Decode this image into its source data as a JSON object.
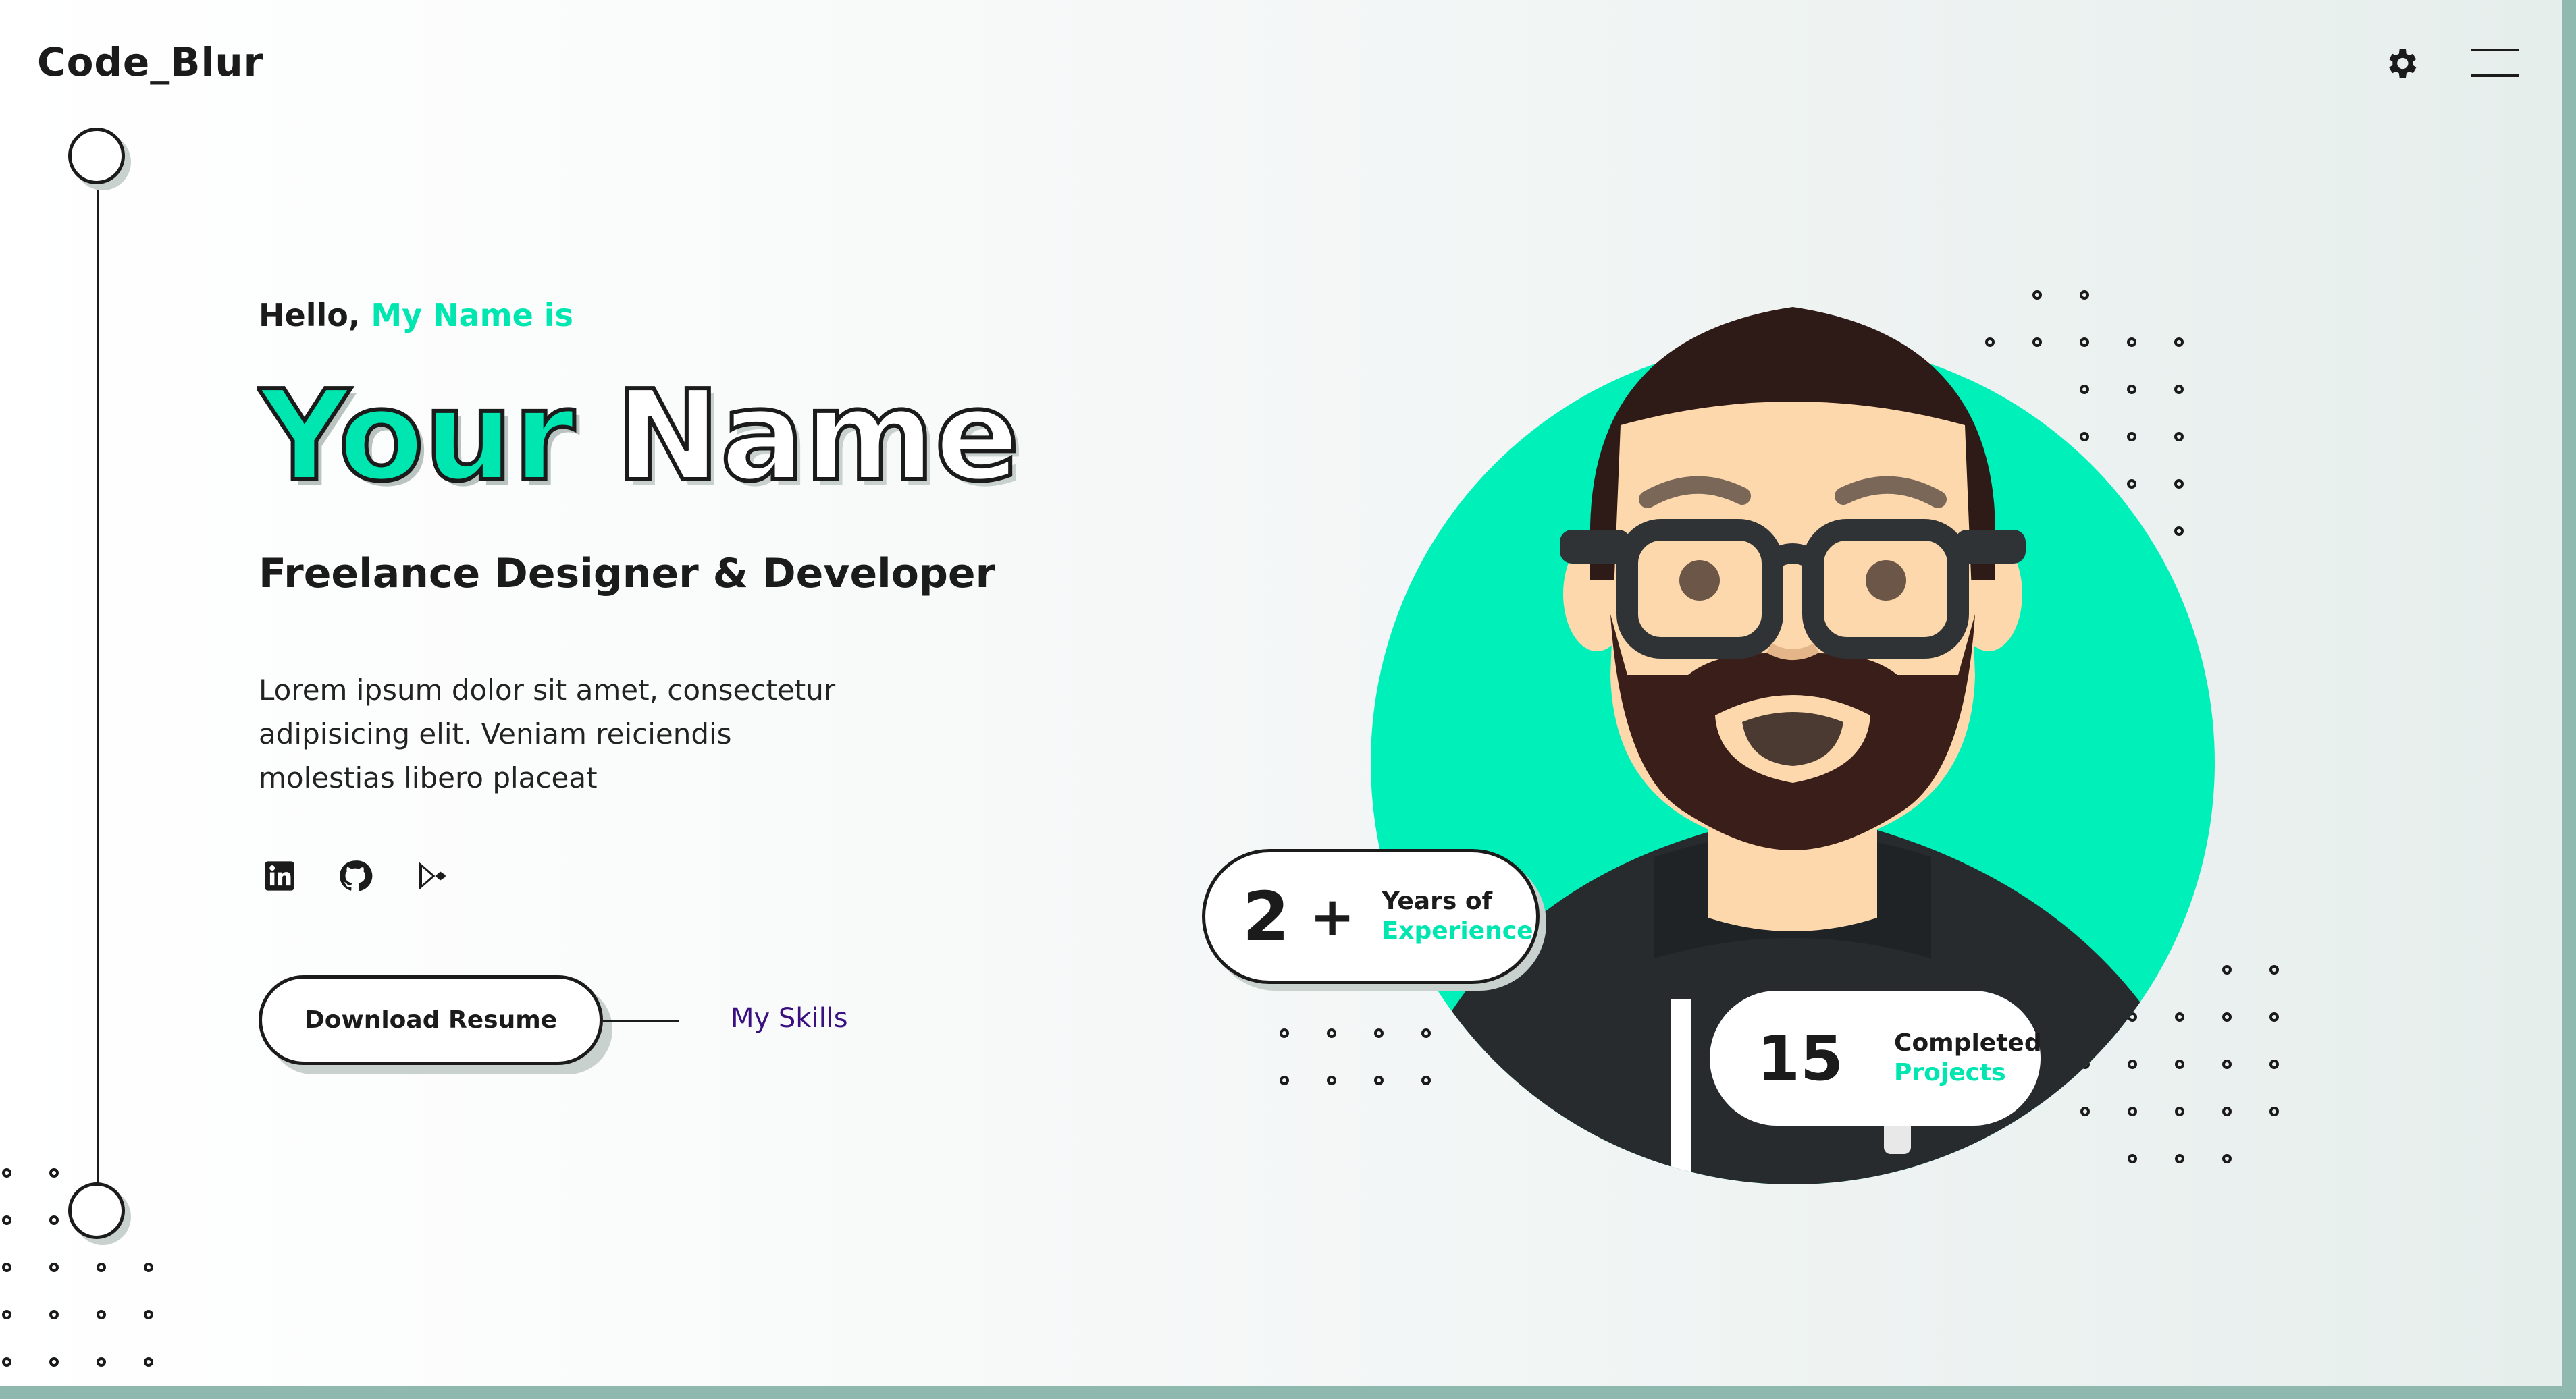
{
  "brand": {
    "logo": "Code_Blur"
  },
  "header": {
    "settings_icon": "gear-icon",
    "menu_icon": "hamburger-menu-icon"
  },
  "hero": {
    "greeting": "Hello,",
    "greeting_accent": "My Name is",
    "name_part1": "Your",
    "name_part2": "Name",
    "role": "Freelance Designer & Developer",
    "description": "Lorem ipsum dolor sit amet, consectetur adipisicing elit. Veniam reiciendis molestias libero placeat",
    "social": [
      {
        "icon": "linkedin-icon"
      },
      {
        "icon": "github-icon"
      },
      {
        "icon": "google-play-icon"
      }
    ],
    "download_label": "Download Resume",
    "skills_label": "My Skills"
  },
  "stats": {
    "experience_number": "2",
    "experience_plus": "+",
    "experience_line1": "Years of",
    "experience_line2": "Experience",
    "projects_number": "15",
    "projects_line1": "Completed",
    "projects_line2": "Projects"
  },
  "colors": {
    "accent": "#00e6b0",
    "dark": "#1b1b1b",
    "link": "#3a1080",
    "skin": "#fcd8ac",
    "hair": "#2e1a16"
  }
}
